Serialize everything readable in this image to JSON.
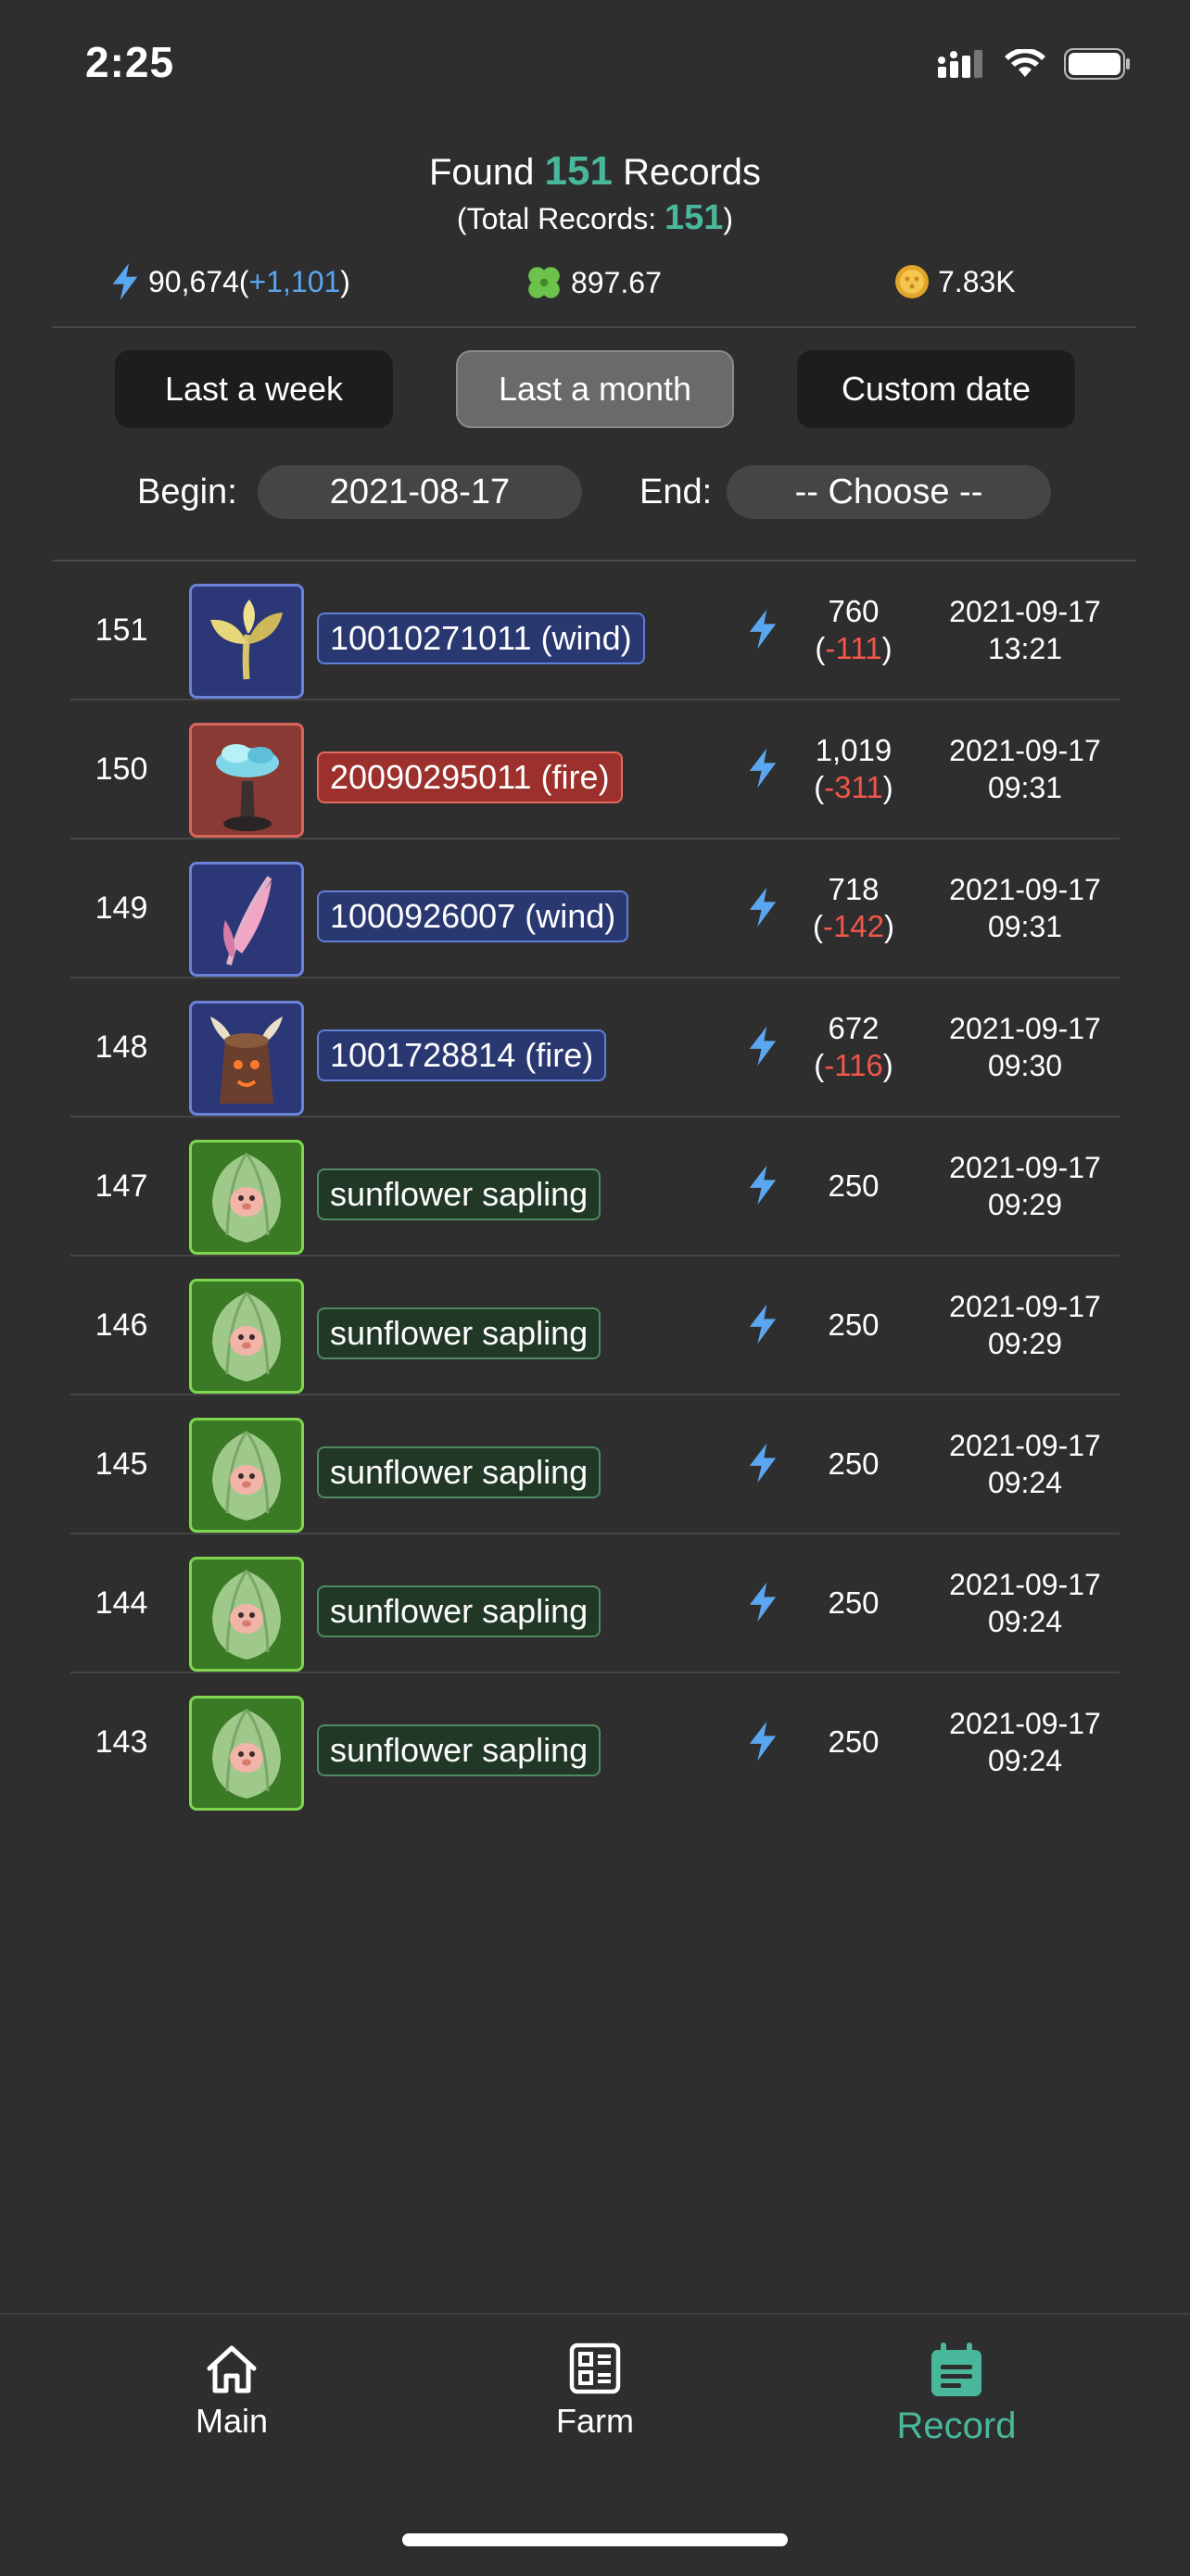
{
  "status_bar": {
    "time": "2:25"
  },
  "summary": {
    "found_prefix": "Found",
    "found_count": "151",
    "found_suffix": "Records",
    "total_prefix": "(Total Records:",
    "total_count": "151",
    "total_suffix": ")"
  },
  "stats": {
    "energy": "90,674",
    "energy_open": "(",
    "energy_delta": "+1,101",
    "energy_close": ")",
    "clover": "897.67",
    "coin": "7.83K"
  },
  "filters": {
    "week": "Last a week",
    "month": "Last a month",
    "custom": "Custom date",
    "active": "month"
  },
  "dates": {
    "begin_label": "Begin:",
    "begin_value": "2021-08-17",
    "end_label": "End:",
    "end_value": "-- Choose --"
  },
  "records": [
    {
      "num": "151",
      "name": "10010271011 (wind)",
      "color": "blue",
      "icon": "golden-sprout",
      "energy": "760",
      "delta": "-111",
      "date": "2021-09-17",
      "time": "13:21"
    },
    {
      "num": "150",
      "name": "20090295011 (fire)",
      "color": "red",
      "icon": "blue-mushroom-tree",
      "energy": "1,019",
      "delta": "-311",
      "date": "2021-09-17",
      "time": "09:31"
    },
    {
      "num": "149",
      "name": "1000926007 (wind)",
      "color": "blue",
      "icon": "pink-feather-plant",
      "energy": "718",
      "delta": "-142",
      "date": "2021-09-17",
      "time": "09:31"
    },
    {
      "num": "148",
      "name": "1001728814 (fire)",
      "color": "blue",
      "icon": "horned-stump",
      "energy": "672",
      "delta": "-116",
      "date": "2021-09-17",
      "time": "09:30"
    },
    {
      "num": "147",
      "name": "sunflower sapling",
      "color": "green",
      "icon": "sunflower-sapling",
      "energy": "250",
      "delta": "",
      "date": "2021-09-17",
      "time": "09:29"
    },
    {
      "num": "146",
      "name": "sunflower sapling",
      "color": "green",
      "icon": "sunflower-sapling",
      "energy": "250",
      "delta": "",
      "date": "2021-09-17",
      "time": "09:29"
    },
    {
      "num": "145",
      "name": "sunflower sapling",
      "color": "green",
      "icon": "sunflower-sapling",
      "energy": "250",
      "delta": "",
      "date": "2021-09-17",
      "time": "09:24"
    },
    {
      "num": "144",
      "name": "sunflower sapling",
      "color": "green",
      "icon": "sunflower-sapling",
      "energy": "250",
      "delta": "",
      "date": "2021-09-17",
      "time": "09:24"
    },
    {
      "num": "143",
      "name": "sunflower sapling",
      "color": "green",
      "icon": "sunflower-sapling",
      "energy": "250",
      "delta": "",
      "date": "2021-09-17",
      "time": "09:24"
    }
  ],
  "tabs": {
    "main": "Main",
    "farm": "Farm",
    "record": "Record",
    "active": "record"
  },
  "colors": {
    "accent": "#49b89a",
    "energy_blue": "#5aa6f0",
    "negative_red": "#f0564a",
    "background": "#2e2e2e"
  }
}
